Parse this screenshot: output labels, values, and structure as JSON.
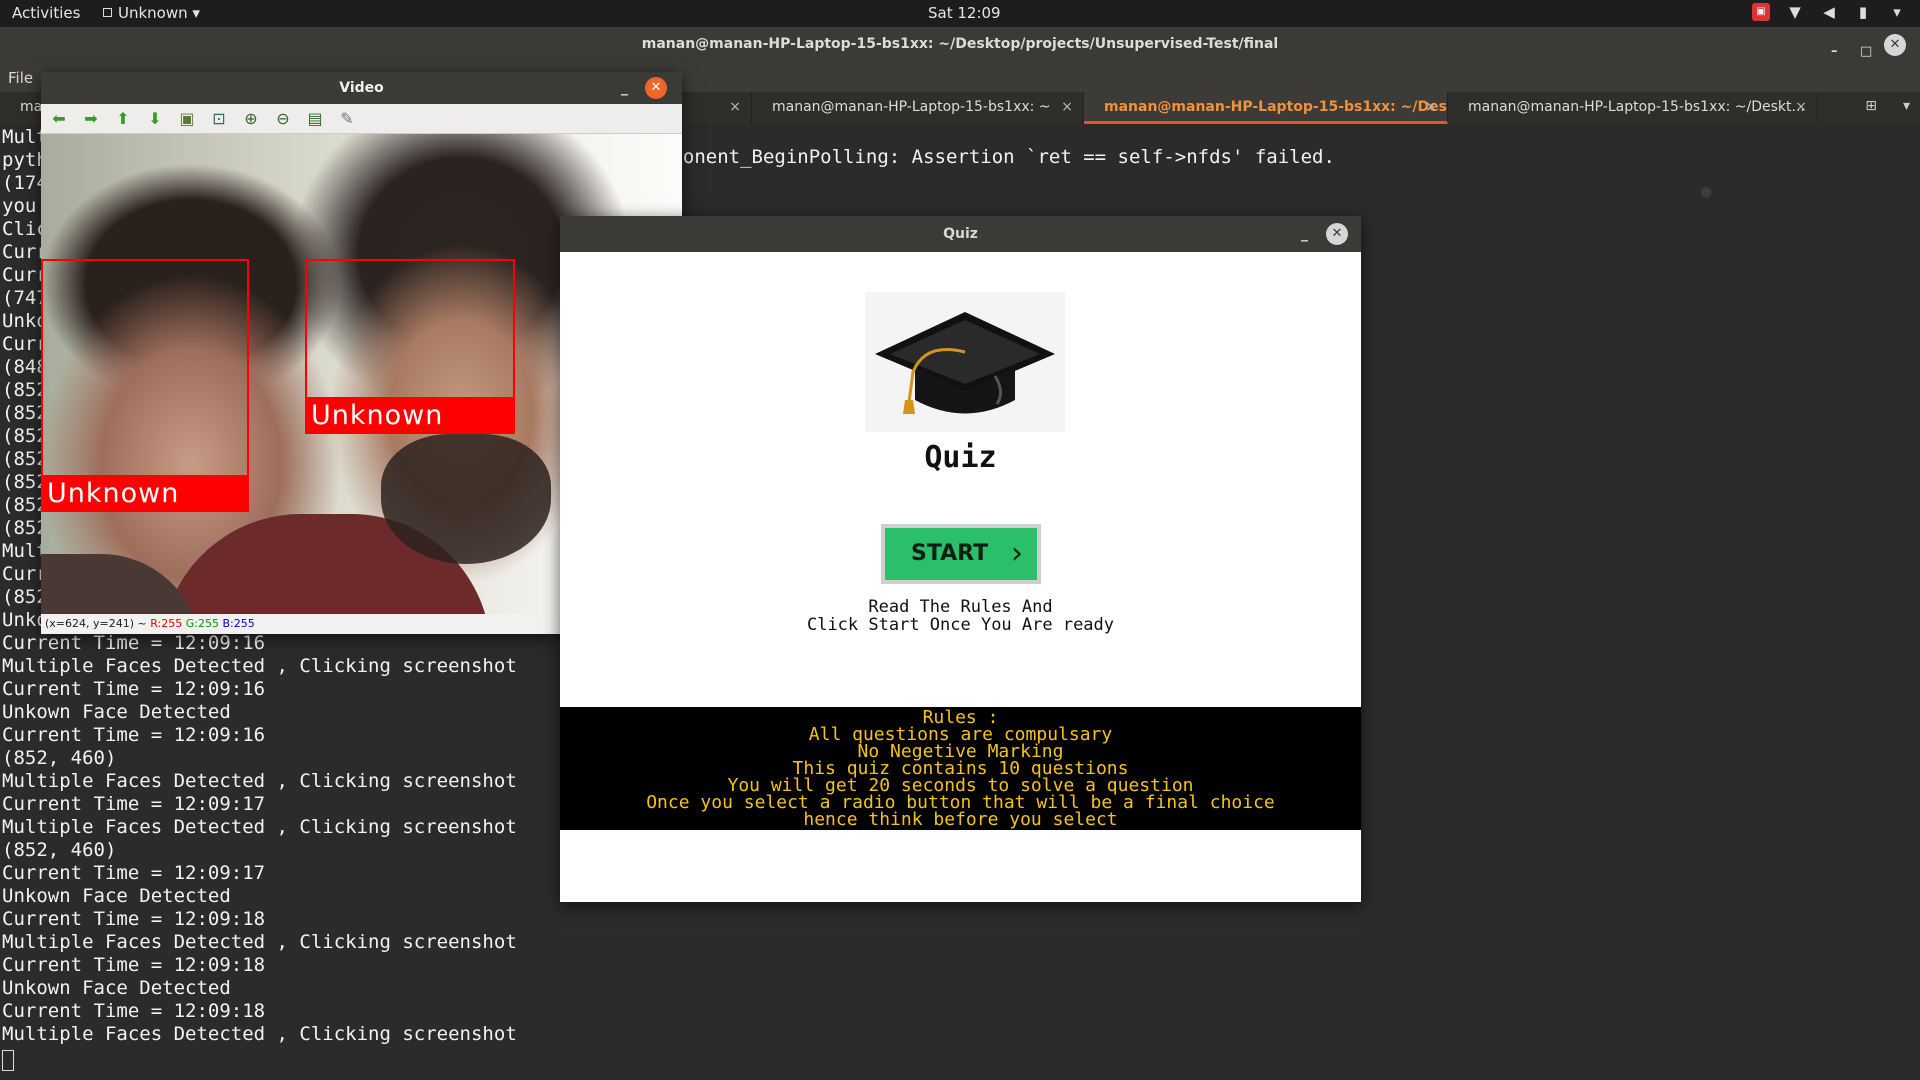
{
  "topbar": {
    "activities": "Activities",
    "app_menu": "Unknown",
    "clock": "Sat 12:09"
  },
  "terminal": {
    "title": "manan@manan-HP-Laptop-15-bs1xx: ~/Desktop/projects/Unsupervised-Test/final",
    "menu_file": "File",
    "tabs": [
      {
        "label": "ma",
        "close": "×"
      },
      {
        "label": "manan@manan-HP-Laptop-15-bs1xx: ~",
        "close": "×"
      },
      {
        "label": "manan@manan-HP-Laptop-15-bs1xx: ~/Des...",
        "close": "×"
      },
      {
        "label": "manan@manan-HP-Laptop-15-bs1xx: ~/Deskt...",
        "close": "×"
      }
    ],
    "error_text": "mponent_BeginPolling: Assertion `ret == self->nfds' failed.",
    "hidden_lines": [
      "Mult",
      "pyth",
      "(174",
      "you ",
      "Clic",
      "Curr",
      "Curr",
      "(747",
      "Unko",
      "Curr",
      "(848",
      "(852",
      "(852",
      "(852",
      "(852",
      "(852",
      "(852",
      "(852",
      "Mult",
      "Curr",
      "(852",
      "Unko"
    ],
    "lines": [
      "Current Time = 12:09:16",
      "Multiple Faces Detected , Clicking screenshot",
      "Current Time = 12:09:16",
      "Unkown Face Detected",
      "Current Time = 12:09:16",
      "(852, 460)",
      "Multiple Faces Detected , Clicking screenshot",
      "Current Time = 12:09:17",
      "Multiple Faces Detected , Clicking screenshot",
      "(852, 460)",
      "Current Time = 12:09:17",
      "Unkown Face Detected",
      "Current Time = 12:09:18",
      "Multiple Faces Detected , Clicking screenshot",
      "Current Time = 12:09:18",
      "Unkown Face Detected",
      "Current Time = 12:09:18",
      "Multiple Faces Detected , Clicking screenshot"
    ]
  },
  "video": {
    "title": "Video",
    "toolbar_icons": [
      "arrow-left-icon",
      "arrow-right-icon",
      "arrow-up-icon",
      "arrow-down-icon",
      "image-icon",
      "fit-window-icon",
      "zoom-in-icon",
      "zoom-out-icon",
      "save-icon",
      "properties-icon"
    ],
    "face_label": "Unknown",
    "status_coords": "(x=624, y=241) ~",
    "status_r": "R:255",
    "status_g": "G:255",
    "status_b": "B:255"
  },
  "quiz": {
    "title": "Quiz",
    "heading": "Quiz",
    "start_label": "START",
    "instructions": [
      "Read The Rules And",
      "Click Start Once You Are ready"
    ],
    "rules": [
      "Rules :",
      "All questions are compulsary",
      "No Negetive Marking",
      "This quiz contains 10 questions",
      "You will get 20 seconds to solve a question",
      "Once you select a radio button that will be a final choice",
      "hence think before you select"
    ]
  },
  "colors": {
    "accent": "#e95420",
    "face_box": "#ff0000",
    "start_button": "#2bbf6a",
    "rules_text": "#f5c21a"
  }
}
